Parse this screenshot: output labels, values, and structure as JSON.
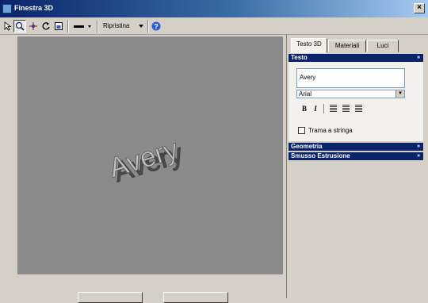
{
  "window": {
    "title": "Finestra 3D",
    "close_label": "×"
  },
  "toolbar": {
    "reset_label": "Ripristina"
  },
  "viewport": {
    "preview_text": "Avery"
  },
  "panel": {
    "tabs": [
      {
        "label": "Testo 3D",
        "active": true
      },
      {
        "label": "Materiali",
        "active": false
      },
      {
        "label": "Luci",
        "active": false
      }
    ],
    "text_section": {
      "title": "Testo",
      "chevron": "»",
      "text_value": "Avery",
      "font_value": "Arial",
      "bold_label": "B",
      "italic_label": "I",
      "path_checkbox_label": "Trama a stringa"
    },
    "geometry_section": {
      "title": "Geometria",
      "chevron": "»"
    },
    "bevel_section": {
      "title": "Smusso Estrusione",
      "chevron": "»"
    }
  },
  "colors": {
    "title_bar": "#0a246a",
    "viewport": "#8a8a8a",
    "panel_bg": "#d4d0c8"
  }
}
